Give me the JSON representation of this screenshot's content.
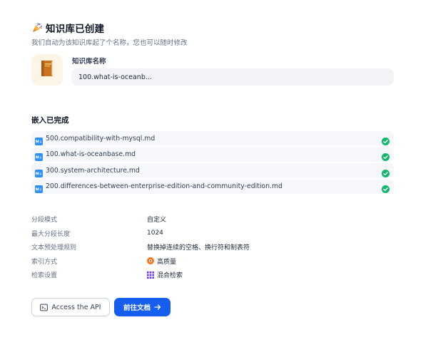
{
  "header": {
    "title": "知识库已创建",
    "subtitle": "我们自动为该知识库起了个名称，您也可以随时修改",
    "icon": "party-popper-icon"
  },
  "kb_name": {
    "label": "知识库名称",
    "value": "100.what-is-oceanb...",
    "icon": "book-icon"
  },
  "embedding": {
    "title": "嵌入已完成",
    "files": [
      {
        "name": "500.compatibility-with-mysql.md",
        "status": "completed"
      },
      {
        "name": "100.what-is-oceanbase.md",
        "status": "completed"
      },
      {
        "name": "300.system-architecture.md",
        "status": "completed"
      },
      {
        "name": "200.differences-between-enterprise-edition-and-community-edition.md",
        "status": "completed"
      }
    ]
  },
  "settings": {
    "rows": [
      {
        "key": "分段模式",
        "value": "自定义"
      },
      {
        "key": "最大分段长度",
        "value": "1024"
      },
      {
        "key": "文本预处理规则",
        "value": "替换掉连续的空格、换行符和制表符"
      },
      {
        "key": "索引方式",
        "value": "高质量",
        "icon": "high-quality-icon"
      },
      {
        "key": "检索设置",
        "value": "混合检索",
        "icon": "hybrid-search-icon"
      }
    ]
  },
  "actions": {
    "api_label": "Access the API",
    "go_label": "前往文档"
  },
  "colors": {
    "primary": "#155eef",
    "success": "#12b76a",
    "md_badge": "#2e90fa",
    "quality": "#f04438",
    "hybrid": "#6938ef"
  }
}
